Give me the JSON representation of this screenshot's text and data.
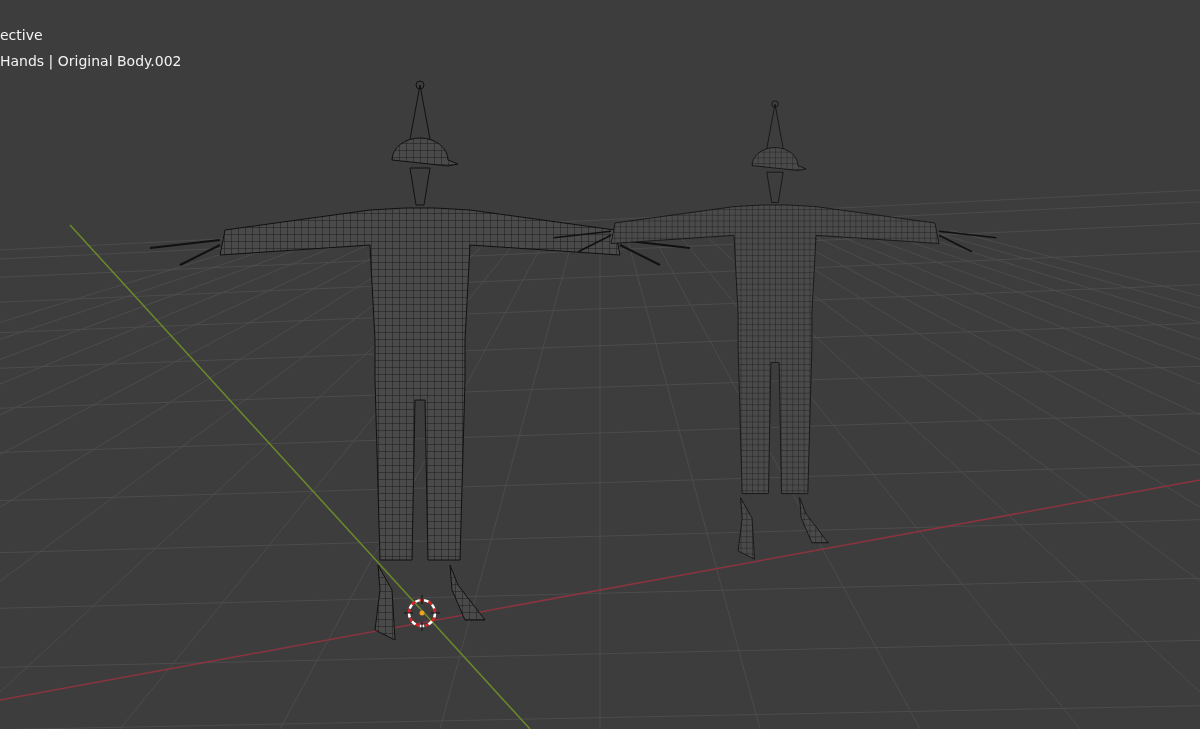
{
  "viewport": {
    "view_label": "ective",
    "object_label": "Hands | Original Body.002"
  }
}
